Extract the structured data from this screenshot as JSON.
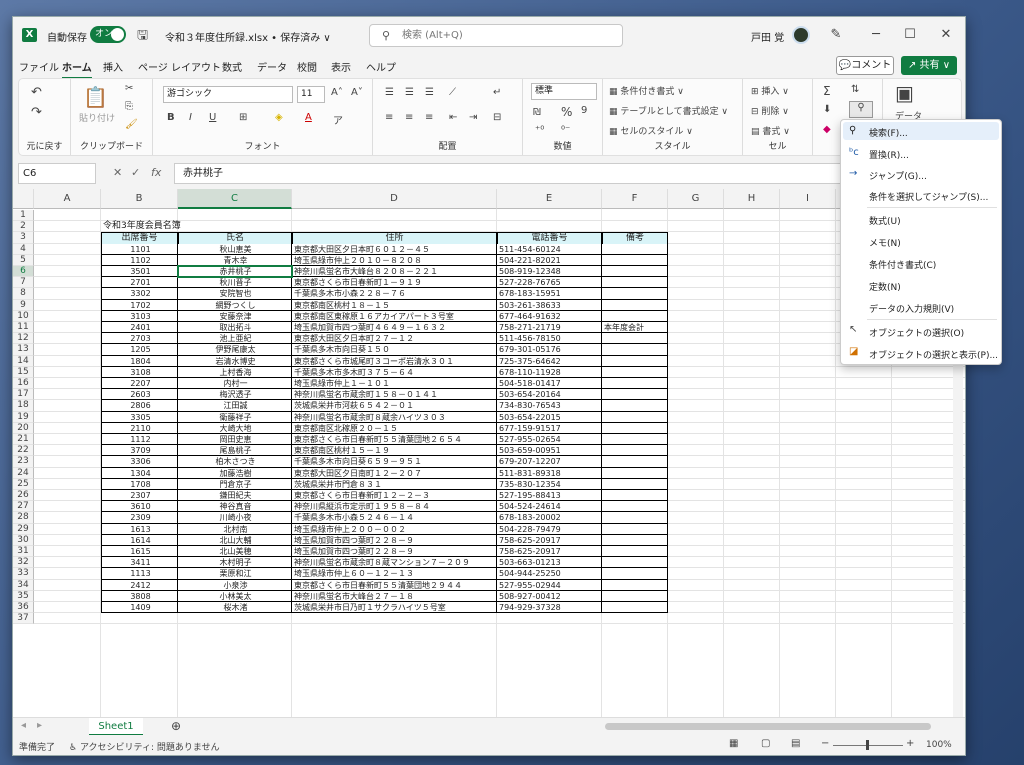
{
  "title": {
    "autosave": "自動保存",
    "toggle": "オン",
    "doc": "令和３年度住所録.xlsx • 保存済み ∨",
    "search": "検索 (Alt+Q)",
    "user": "戸田 覚"
  },
  "menu": [
    "ファイル",
    "ホーム",
    "挿入",
    "ページ レイアウト",
    "数式",
    "データ",
    "校閲",
    "表示",
    "ヘルプ"
  ],
  "menu_active": "ホーム",
  "comment": "コメント",
  "share": "共有",
  "ribbon": {
    "undo_label": "元に戻す",
    "clipboard_label": "クリップボード",
    "paste": "貼り付け",
    "font_name": "游ゴシック",
    "font_size": "11",
    "font_label": "フォント",
    "align_label": "配置",
    "number_format": "標準",
    "number_label": "数値",
    "cond": "条件付き書式 ∨",
    "table": "テーブルとして書式設定 ∨",
    "cellstyle": "セルのスタイル ∨",
    "style_label": "スタイル",
    "insert": "挿入 ∨",
    "delete": "削除 ∨",
    "format": "書式 ∨",
    "cells_label": "セル",
    "edit_label": "編",
    "data_label": "データ"
  },
  "namebox": "C6",
  "formula": "赤井桃子",
  "cols": [
    "A",
    "B",
    "C",
    "D",
    "E",
    "F",
    "G",
    "H",
    "I",
    "J"
  ],
  "sheet_title": "令和3年度会員名簿",
  "headers": [
    "出席番号",
    "氏名",
    "住所",
    "電話番号",
    "備考"
  ],
  "rows": [
    [
      "1101",
      "秋山恵美",
      "東京都大田区夕日本町６０１２－４５",
      "511-454-60124",
      ""
    ],
    [
      "1102",
      "青木幸",
      "埼玉県綠市仲上２０１０－８２０８",
      "504-221-82021",
      ""
    ],
    [
      "3501",
      "赤井桃子",
      "神奈川県蛍名市大峰台８２０８－２２１",
      "508-919-12348",
      ""
    ],
    [
      "2701",
      "秋川晋子",
      "東京都さくら市日春新町１－９１９",
      "527-228-76765",
      ""
    ],
    [
      "3302",
      "安院智也",
      "千葉県多木市小森２２８－７６",
      "678-183-15951",
      ""
    ],
    [
      "1702",
      "網野つくし",
      "東京都南区桃村１８－１５",
      "503-261-38633",
      ""
    ],
    [
      "3103",
      "安藤奈津",
      "東京都南区東稼原１６アカイアパート３号室",
      "677-464-91632",
      ""
    ],
    [
      "2401",
      "取出拓斗",
      "埼玉県加賀市四つ葉町４６４９－１６３２",
      "758-271-21719",
      "本年度会計"
    ],
    [
      "2703",
      "池上亜紀",
      "東京都大田区夕日本町２７－１２",
      "511-456-78150",
      ""
    ],
    [
      "1205",
      "伊野尾康太",
      "千葉県多木市向日葵１５０",
      "679-301-05176",
      ""
    ],
    [
      "1804",
      "岩清水博史",
      "東京都さくら市城尾町３コーポ岩清水３０１",
      "725-375-64642",
      ""
    ],
    [
      "3108",
      "上村香海",
      "千葉県多木市多木町３７５－６４",
      "678-110-11928",
      ""
    ],
    [
      "2207",
      "内村一",
      "埼玉県綠市仲上１－１０１",
      "504-518-01417",
      ""
    ],
    [
      "2603",
      "梅沢透子",
      "神奈川県蛍名市蔵余町１５８－０１４１",
      "503-654-20164",
      ""
    ],
    [
      "2806",
      "江田誠",
      "茨城県栄井市河萩６５４２－０１",
      "734-830-76543",
      ""
    ],
    [
      "3305",
      "衛藤祥子",
      "神奈川県蛍名市蔵余町８蔵余ハイツ３０３",
      "503-654-22015",
      ""
    ],
    [
      "2110",
      "大崎大地",
      "東京都南区北稼原２０－１５",
      "677-159-91517",
      ""
    ],
    [
      "1112",
      "岡田史恵",
      "東京都さくら市日春新町５５清葉団地２６５４",
      "527-955-02654",
      ""
    ],
    [
      "3709",
      "尾島桃子",
      "東京都南区桃村１５－１９",
      "503-659-00951",
      ""
    ],
    [
      "3306",
      "柏木さつき",
      "千葉県多木市向日葵６５９－９５１",
      "679-207-12207",
      ""
    ],
    [
      "1304",
      "加藤浩樹",
      "東京都大田区夕日南町１２－２０７",
      "511-831-89318",
      ""
    ],
    [
      "1708",
      "門倉京子",
      "茨城県栄井市門倉８３１",
      "735-830-12354",
      ""
    ],
    [
      "2307",
      "鎌田紀夫",
      "東京都さくら市日春新町１２－２－３",
      "527-195-88413",
      ""
    ],
    [
      "3610",
      "神谷真音",
      "神奈川県縦浜市定示町１９５８－８４",
      "504-524-24614",
      ""
    ],
    [
      "2309",
      "川崎小夜",
      "千葉県多木市小森５２４６－１４",
      "678-183-20002",
      ""
    ],
    [
      "1613",
      "北村南",
      "埼玉県綠市仲上２００－００２",
      "504-228-79479",
      ""
    ],
    [
      "1614",
      "北山大輔",
      "埼玉県加賀市四つ葉町２２８－９",
      "758-625-20917",
      ""
    ],
    [
      "1615",
      "北山美穂",
      "埼玉県加賀市四つ葉町２２８－９",
      "758-625-20917",
      ""
    ],
    [
      "3411",
      "木村明子",
      "神奈川県蛍名市蔵余町８蔵マンション７－２０９",
      "503-663-01213",
      ""
    ],
    [
      "1113",
      "栗原和江",
      "埼玉県綠市仲上６０－１２－１３",
      "504-944-25250",
      ""
    ],
    [
      "2412",
      "小泉渉",
      "東京都さくら市日春新町５５清葉団地２９４４",
      "527-955-02944",
      ""
    ],
    [
      "3808",
      "小林美太",
      "神奈川県蛍名市大峰台２７－１８",
      "508-927-00412",
      ""
    ],
    [
      "1409",
      "桜木渚",
      "茨城県栄井市日乃町１サクラハイツ５号室",
      "794-929-37328",
      ""
    ]
  ],
  "sheet_tab": "Sheet1",
  "status": {
    "ready": "準備完了",
    "access": "アクセシビリティ: 問題ありません",
    "zoom": "100%"
  },
  "popup": [
    "検索(F)...",
    "置換(R)...",
    "ジャンプ(G)...",
    "条件を選択してジャンプ(S)...",
    "数式(U)",
    "メモ(N)",
    "条件付き書式(C)",
    "定数(N)",
    "データの入力規則(V)",
    "オブジェクトの選択(O)",
    "オブジェクトの選択と表示(P)..."
  ]
}
